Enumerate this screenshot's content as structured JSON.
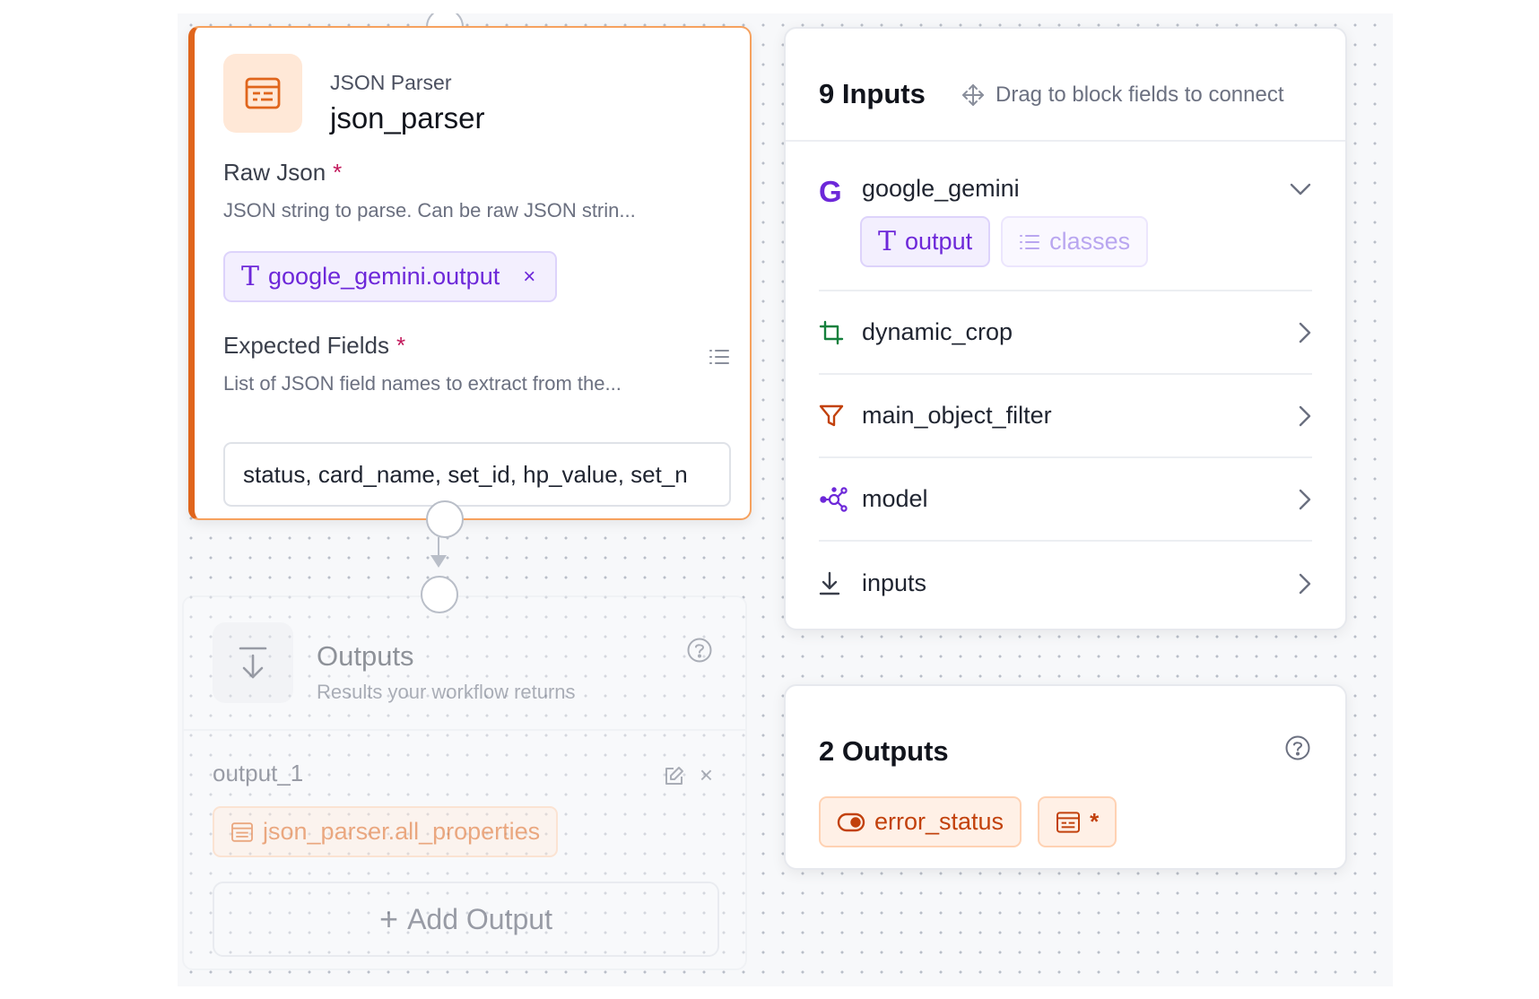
{
  "parser_block": {
    "type_label": "JSON Parser",
    "name": "json_parser",
    "raw_json": {
      "label": "Raw Json",
      "required_mark": "*",
      "description": "JSON string to parse. Can be raw JSON strin...",
      "binding": "google_gemini.output",
      "remove_icon": "×"
    },
    "expected_fields": {
      "label": "Expected Fields",
      "required_mark": "*",
      "description": "List of JSON field names to extract from the...",
      "value": "status, card_name, set_id, hp_value, set_n"
    }
  },
  "outputs_block": {
    "title": "Outputs",
    "subtitle": "Results your workflow returns",
    "output_name": "output_1",
    "output_binding": "json_parser.all_properties",
    "remove_icon": "×",
    "add_button": "Add Output",
    "add_plus": "+"
  },
  "inputs_panel": {
    "title": "9 Inputs",
    "hint": "Drag to block fields to connect",
    "google_letter": "G",
    "rows": [
      {
        "label": "google_gemini",
        "icon": "google-icon",
        "expanded": true
      },
      {
        "label": "dynamic_crop",
        "icon": "crop-icon"
      },
      {
        "label": "main_object_filter",
        "icon": "filter-icon"
      },
      {
        "label": "model",
        "icon": "model-graph-icon"
      },
      {
        "label": "inputs",
        "icon": "download-icon"
      }
    ],
    "sub_chips": [
      "output",
      "classes"
    ]
  },
  "outputs_panel": {
    "title": "2 Outputs",
    "chips": [
      "error_status",
      "*"
    ]
  },
  "colors": {
    "accent_orange": "#e0651c",
    "accent_violet": "#6d28d9",
    "required_red": "#c2185b"
  }
}
